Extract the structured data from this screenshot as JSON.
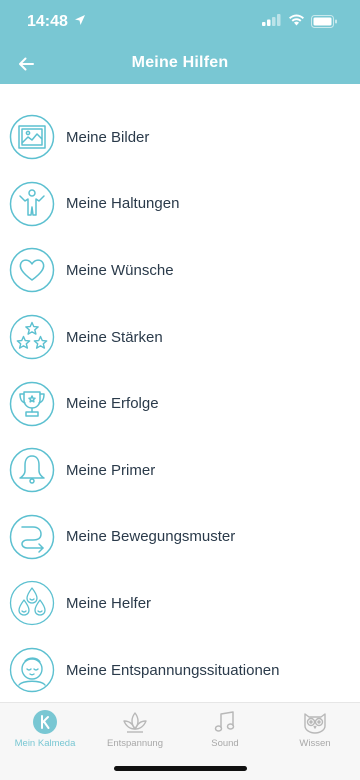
{
  "status_bar": {
    "time": "14:48"
  },
  "header": {
    "title": "Meine Hilfen",
    "back_icon": "arrow-left-icon"
  },
  "list": {
    "items": [
      {
        "label": "Meine Bilder",
        "icon": "picture-icon"
      },
      {
        "label": "Meine Haltungen",
        "icon": "person-icon"
      },
      {
        "label": "Meine Wünsche",
        "icon": "heart-icon"
      },
      {
        "label": "Meine Stärken",
        "icon": "stars-icon"
      },
      {
        "label": "Meine Erfolge",
        "icon": "trophy-icon"
      },
      {
        "label": "Meine Primer",
        "icon": "bell-icon"
      },
      {
        "label": "Meine Bewegungsmuster",
        "icon": "movement-pattern-icon"
      },
      {
        "label": "Meine Helfer",
        "icon": "helpers-icon"
      },
      {
        "label": "Meine Entspannungssituationen",
        "icon": "relaxation-icon"
      }
    ]
  },
  "tab_bar": {
    "tabs": [
      {
        "label": "Mein Kalmeda",
        "icon": "kalmeda-logo-icon",
        "active": true
      },
      {
        "label": "Entspannung",
        "icon": "lotus-icon",
        "active": false
      },
      {
        "label": "Sound",
        "icon": "music-note-icon",
        "active": false
      },
      {
        "label": "Wissen",
        "icon": "owl-icon",
        "active": false
      }
    ]
  },
  "colors": {
    "accent": "#79c7d3",
    "text": "#2a3a4a",
    "tab_inactive": "#a8a8a8"
  }
}
